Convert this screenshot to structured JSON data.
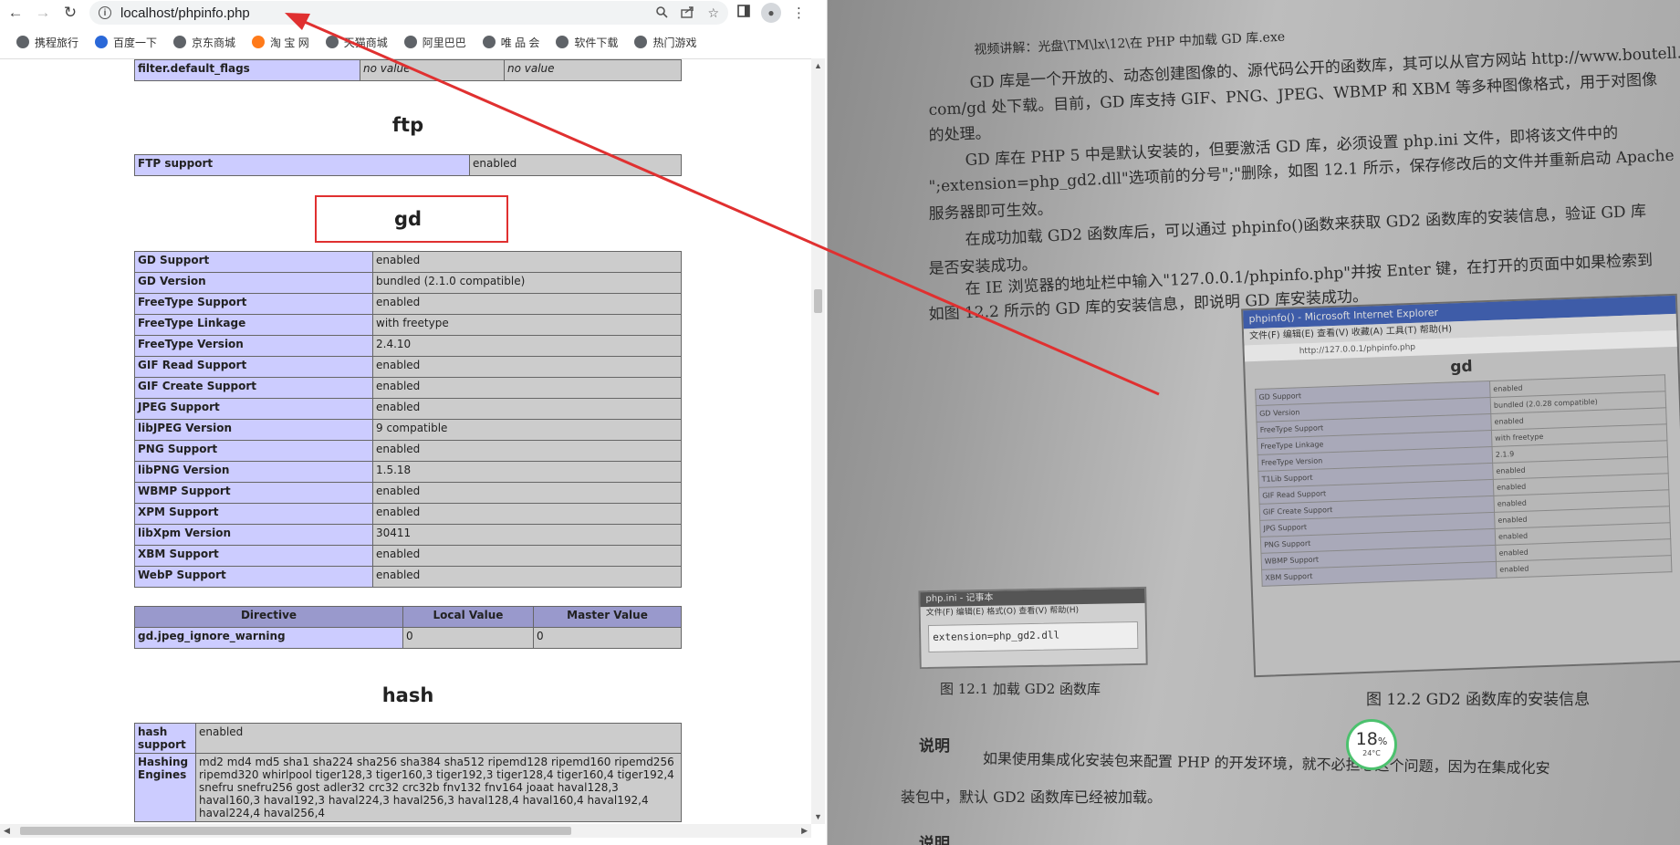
{
  "browser": {
    "url": "localhost/phpinfo.php",
    "nav": {
      "back": "←",
      "forward": "→",
      "reload": "↻"
    },
    "icons": [
      "info-icon",
      "zoom-icon",
      "share-icon",
      "star-icon",
      "sidebar-icon",
      "profile-icon",
      "menu-icon"
    ]
  },
  "bookmarks": [
    {
      "label": "携程旅行",
      "icon": "globe-icon"
    },
    {
      "label": "百度一下",
      "icon": "baidu-icon"
    },
    {
      "label": "京东商城",
      "icon": "globe-icon"
    },
    {
      "label": "淘 宝 网",
      "icon": "taobao-icon"
    },
    {
      "label": "天猫商城",
      "icon": "globe-icon"
    },
    {
      "label": "阿里巴巴",
      "icon": "globe-icon"
    },
    {
      "label": "唯 品 会",
      "icon": "globe-icon"
    },
    {
      "label": "软件下载",
      "icon": "globe-icon"
    },
    {
      "label": "热门游戏",
      "icon": "globe-icon"
    }
  ],
  "page": {
    "filter_row": {
      "name": "filter.default_flags",
      "local": "no value",
      "master": "no value"
    },
    "ftp": {
      "title": "ftp",
      "rows": [
        {
          "name": "FTP support",
          "value": "enabled"
        }
      ]
    },
    "gd": {
      "title": "gd",
      "rows": [
        {
          "name": "GD Support",
          "value": "enabled"
        },
        {
          "name": "GD Version",
          "value": "bundled (2.1.0 compatible)"
        },
        {
          "name": "FreeType Support",
          "value": "enabled"
        },
        {
          "name": "FreeType Linkage",
          "value": "with freetype"
        },
        {
          "name": "FreeType Version",
          "value": "2.4.10"
        },
        {
          "name": "GIF Read Support",
          "value": "enabled"
        },
        {
          "name": "GIF Create Support",
          "value": "enabled"
        },
        {
          "name": "JPEG Support",
          "value": "enabled"
        },
        {
          "name": "libJPEG Version",
          "value": "9 compatible"
        },
        {
          "name": "PNG Support",
          "value": "enabled"
        },
        {
          "name": "libPNG Version",
          "value": "1.5.18"
        },
        {
          "name": "WBMP Support",
          "value": "enabled"
        },
        {
          "name": "XPM Support",
          "value": "enabled"
        },
        {
          "name": "libXpm Version",
          "value": "30411"
        },
        {
          "name": "XBM Support",
          "value": "enabled"
        },
        {
          "name": "WebP Support",
          "value": "enabled"
        }
      ],
      "directive_headers": [
        "Directive",
        "Local Value",
        "Master Value"
      ],
      "directives": [
        {
          "name": "gd.jpeg_ignore_warning",
          "local": "0",
          "master": "0"
        }
      ]
    },
    "hash": {
      "title": "hash",
      "rows": [
        {
          "name": "hash support",
          "value": "enabled"
        },
        {
          "name": "Hashing Engines",
          "value": "md2 md4 md5 sha1 sha224 sha256 sha384 sha512 ripemd128 ripemd160 ripemd256 ripemd320 whirlpool tiger128,3 tiger160,3 tiger192,3 tiger128,4 tiger160,4 tiger192,4 snefru snefru256 gost adler32 crc32 crc32b fnv132 fnv164 joaat haval128,3 haval160,3 haval192,3 haval224,3 haval256,3 haval128,4 haval160,4 haval192,4 haval224,4 haval256,4"
        }
      ]
    }
  },
  "photo": {
    "lines": [
      "视频讲解：光盘\\TM\\lx\\12\\在 PHP 中加载 GD 库.exe",
      "GD 库是一个开放的、动态创建图像的、源代码公开的函数库，其可以从官方网站 http://www.boutell.",
      "com/gd 处下载。目前，GD 库支持 GIF、PNG、JPEG、WBMP 和 XBM 等多种图像格式，用于对图像",
      "的处理。",
      "GD 库在 PHP 5 中是默认安装的，但要激活 GD 库，必须设置 php.ini 文件，即将该文件中的",
      "\";extension=php_gd2.dll\"选项前的分号\";\"删除，如图 12.1 所示，保存修改后的文件并重新启动 Apache",
      "服务器即可生效。",
      "在成功加载 GD2 函数库后，可以通过 phpinfo()函数来获取 GD2 函数库的安装信息，验证 GD 库",
      "是否安装成功。",
      "在 IE 浏览器的地址栏中输入\"127.0.0.1/phpinfo.php\"并按 Enter 键，在打开的页面中如果检索到",
      "如图 12.2 所示的 GD 库的安装信息，即说明 GD 库安装成功。"
    ],
    "fig2": {
      "window_title": "phpinfo() - Microsoft Internet Explorer",
      "menu": "文件(F)  编辑(E)  查看(V)  收藏(A)  工具(T)  帮助(H)",
      "address": "http://127.0.0.1/phpinfo.php",
      "heading": "gd",
      "rows": [
        [
          "GD Support",
          "enabled"
        ],
        [
          "GD Version",
          "bundled (2.0.28 compatible)"
        ],
        [
          "FreeType Support",
          "enabled"
        ],
        [
          "FreeType Linkage",
          "with freetype"
        ],
        [
          "FreeType Version",
          "2.1.9"
        ],
        [
          "T1Lib Support",
          "enabled"
        ],
        [
          "GIF Read Support",
          "enabled"
        ],
        [
          "GIF Create Support",
          "enabled"
        ],
        [
          "JPG Support",
          "enabled"
        ],
        [
          "PNG Support",
          "enabled"
        ],
        [
          "WBMP Support",
          "enabled"
        ],
        [
          "XBM Support",
          "enabled"
        ]
      ],
      "caption": "图 12.2   GD2 函数库的安装信息"
    },
    "fig1": {
      "window_title": "php.ini - 记事本",
      "menu": "文件(F) 编辑(E) 格式(O) 查看(V) 帮助(H)",
      "body": "extension=php_gd2.dll",
      "caption": "图 12.1   加载 GD2 函数库"
    },
    "note_label": "说明",
    "note_text": "如果使用集成化安装包来配置 PHP 的开发环境，就不必担心这个问题，因为在集成化安",
    "note_text2": "装包中，默认 GD2 函数库已经被加载。",
    "bottom_label": "说明",
    "widget": {
      "value": "18",
      "unit": "%",
      "temp": "24°C"
    }
  },
  "colors": {
    "annotation_red": "#e03030",
    "php_header": "#9999cc",
    "php_key": "#ccccff",
    "php_value": "#cccccc"
  }
}
